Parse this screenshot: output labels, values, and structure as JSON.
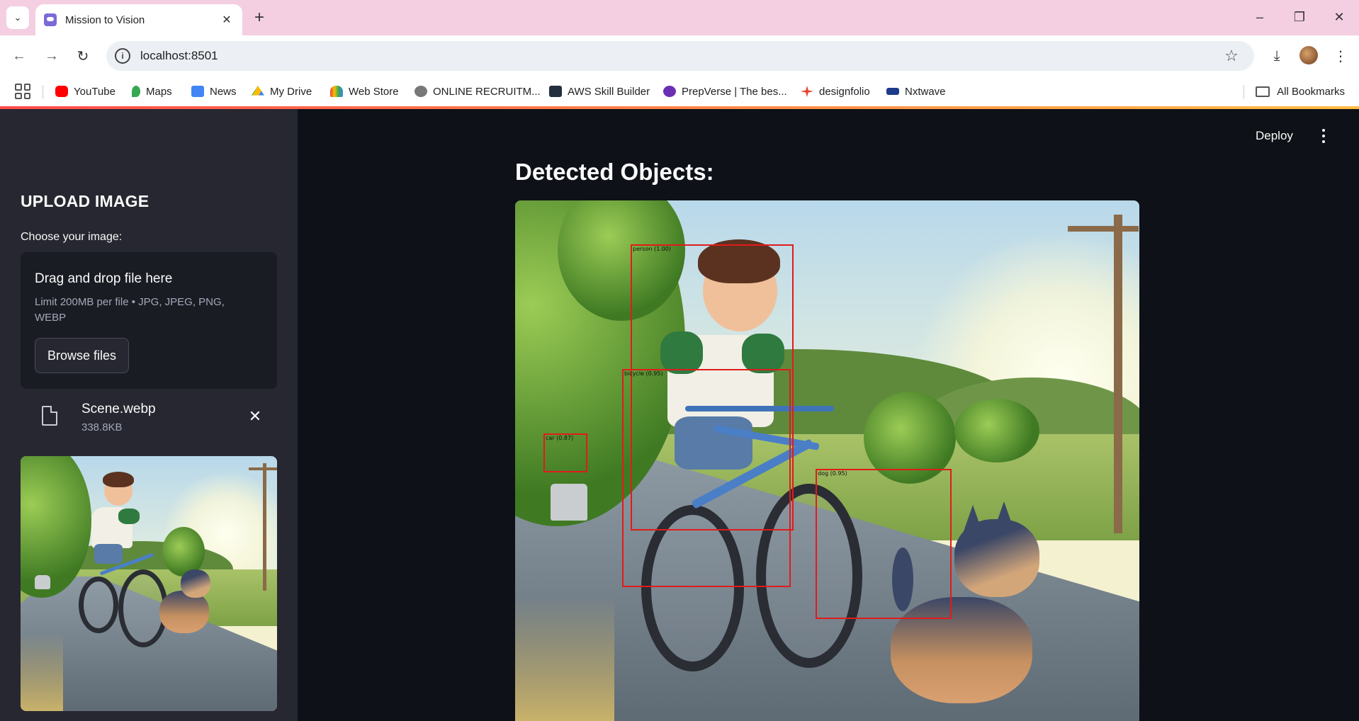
{
  "browser": {
    "tab_title": "Mission to Vision",
    "url": "localhost:8501",
    "bookmarks": [
      "YouTube",
      "Maps",
      "News",
      "My Drive",
      "Web Store",
      "ONLINE RECRUITM...",
      "AWS Skill Builder",
      "PrepVerse | The bes...",
      "designfolio",
      "Nxtwave"
    ],
    "all_bookmarks": "All Bookmarks",
    "colors": {
      "tabbar": "#f4cfe1",
      "omnibox": "#eceff3"
    }
  },
  "app": {
    "deploy_label": "Deploy",
    "colors": {
      "sidebar": "#262730",
      "main": "#0e1117",
      "bbox": "#e11b1b",
      "accent": "#ff4b4b"
    }
  },
  "sidebar": {
    "title": "UPLOAD IMAGE",
    "uploader_label": "Choose your image:",
    "dropzone_heading": "Drag and drop file here",
    "dropzone_limit": "Limit 200MB per file • JPG, JPEG, PNG, WEBP",
    "browse_label": "Browse files",
    "file": {
      "name": "Scene.webp",
      "size": "338.8KB"
    }
  },
  "main": {
    "title": "Detected Objects:",
    "detections": [
      {
        "label": "person (1.00)"
      },
      {
        "label": "bicycle (0.95)"
      },
      {
        "label": "car (0.87)"
      },
      {
        "label": "dog (0.95)"
      }
    ]
  }
}
